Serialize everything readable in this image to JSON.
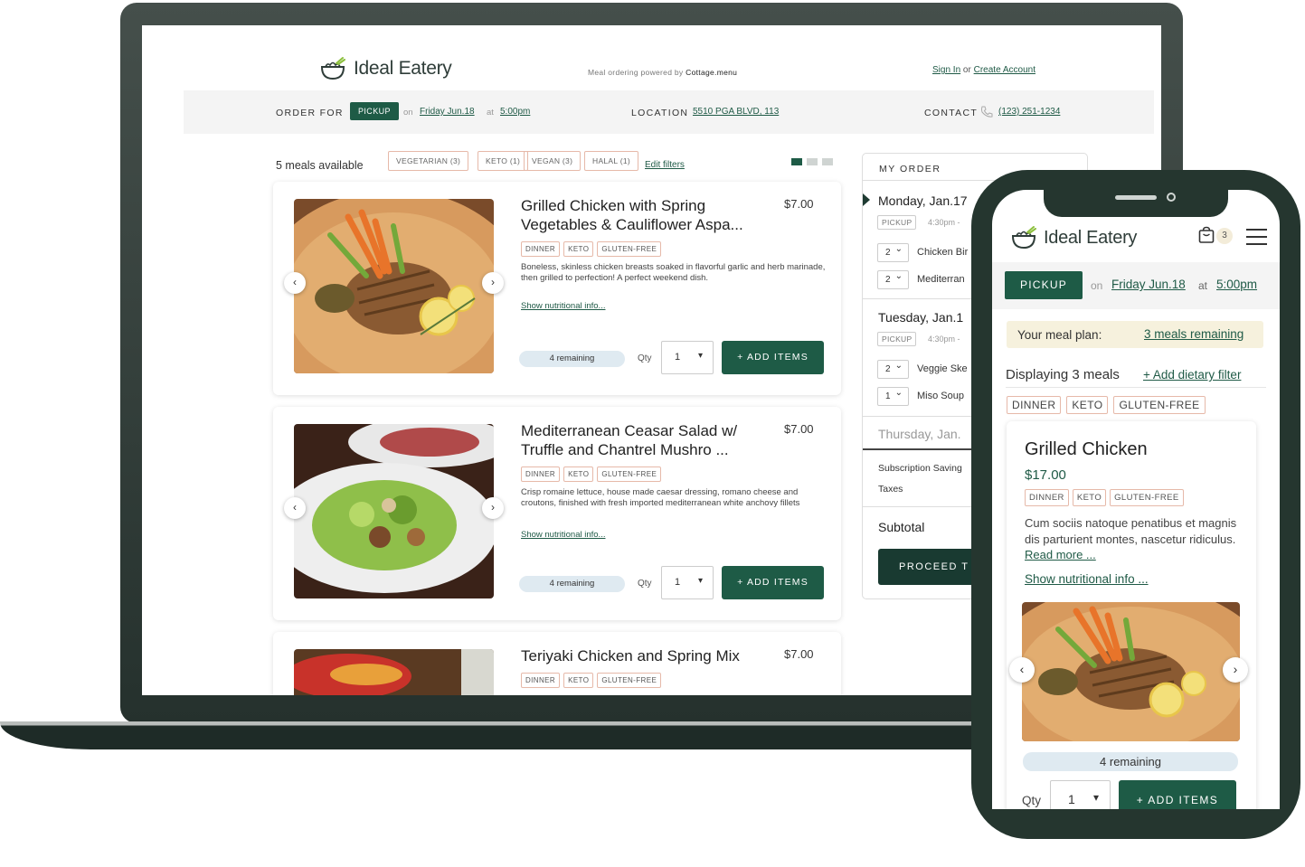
{
  "brand": "Ideal Eatery",
  "desktop": {
    "powered_prefix": "Meal ordering powered by",
    "powered_brand": "Cottage.menu",
    "sign_in": "Sign In",
    "or": "or",
    "create_account": "Create Account",
    "order_for_label": "ORDER FOR",
    "pickup": "PICKUP",
    "on": "on",
    "date": "Friday Jun.18",
    "at": "at",
    "time": "5:00pm",
    "location_label": "LOCATION",
    "location": "5510 PGA BLVD, 113",
    "contact_label": "CONTACT",
    "phone": "(123) 251-1234",
    "meals_available": "5 meals available",
    "filters": [
      "VEGETARIAN (3)",
      "KETO (1)",
      "VEGAN (3)",
      "HALAL (1)"
    ],
    "edit_filters": "Edit filters",
    "meals": [
      {
        "title": "Grilled Chicken with Spring Vegetables & Cauliflower Aspa...",
        "price": "$7.00",
        "tags": [
          "DINNER",
          "KETO",
          "GLUTEN-FREE"
        ],
        "description": "Boneless, skinless chicken breasts soaked in flavorful garlic and herb marinade, then grilled to perfection! A perfect weekend dish.",
        "nutrition_link": "Show nutritional info...",
        "remaining": "4 remaining",
        "qty_label": "Qty",
        "qty": "1",
        "add_label": "+ ADD ITEMS"
      },
      {
        "title": "Mediterranean Ceasar Salad w/ Truffle and Chantrel Mushro ...",
        "price": "$7.00",
        "tags": [
          "DINNER",
          "KETO",
          "GLUTEN-FREE"
        ],
        "description": "Crisp romaine lettuce, house made caesar dressing, romano cheese and croutons, finished with fresh imported mediterranean white anchovy fillets",
        "nutrition_link": "Show nutritional info...",
        "remaining": "4 remaining",
        "qty_label": "Qty",
        "qty": "1",
        "add_label": "+ ADD ITEMS"
      },
      {
        "title": "Teriyaki Chicken and Spring Mix",
        "price": "$7.00",
        "tags": [
          "DINNER",
          "KETO",
          "GLUTEN-FREE"
        ]
      }
    ],
    "order": {
      "title": "MY ORDER",
      "days": [
        {
          "day": "Monday, Jan.17",
          "pickup": "PICKUP",
          "time": "4:30pm -",
          "items": [
            {
              "qty": "2",
              "name": "Chicken Bir"
            },
            {
              "qty": "2",
              "name": "Mediterran"
            }
          ]
        },
        {
          "day": "Tuesday, Jan.1",
          "pickup": "PICKUP",
          "time": "4:30pm -",
          "items": [
            {
              "qty": "2",
              "name": "Veggie Ske"
            },
            {
              "qty": "1",
              "name": "Miso Soup"
            }
          ]
        }
      ],
      "next_day": "Thursday, Jan.",
      "subscription": "Subscription Saving",
      "taxes": "Taxes",
      "subtotal": "Subtotal",
      "proceed": "PROCEED T"
    }
  },
  "mobile": {
    "cart_count": "3",
    "pickup": "PICKUP",
    "on": "on",
    "date": "Friday Jun.18",
    "at": "at",
    "time": "5:00pm",
    "plan_label": "Your meal plan:",
    "plan_value": "3 meals remaining",
    "displaying": "Displaying 3 meals",
    "add_filter": "+ Add dietary filter",
    "filters": [
      "DINNER",
      "KETO",
      "GLUTEN-FREE"
    ],
    "meal": {
      "title": "Grilled Chicken",
      "price": "$17.00",
      "tags": [
        "DINNER",
        "KETO",
        "GLUTEN-FREE"
      ],
      "description": "Cum sociis natoque penatibus et magnis dis parturient montes, nascetur ridiculus.",
      "read_more": "Read more ...",
      "nutrition_link": "Show nutritional info ...",
      "remaining": "4 remaining",
      "qty_label": "Qty",
      "qty": "1",
      "add_label": "+ ADD ITEMS"
    }
  }
}
